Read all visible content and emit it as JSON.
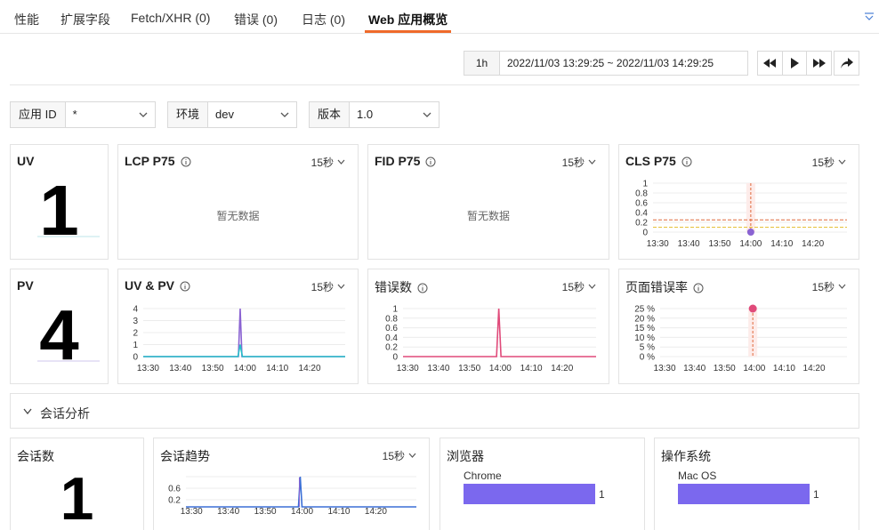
{
  "tabs": [
    "性能",
    "扩展字段",
    "Fetch/XHR (0)",
    "错误 (0)",
    "日志 (0)",
    "Web 应用概览"
  ],
  "time": {
    "range_button": "1h",
    "range_text": "2022/11/03 13:29:25 ~ 2022/11/03 14:29:25"
  },
  "filters": [
    {
      "label": "应用 ID",
      "value": "*"
    },
    {
      "label": "环境",
      "value": "dev"
    },
    {
      "label": "版本",
      "value": "1.0"
    }
  ],
  "interval_label": "15秒",
  "no_data_text": "暂无数据",
  "panels": {
    "uv": {
      "title": "UV",
      "value": "1"
    },
    "lcp": {
      "title": "LCP P75"
    },
    "fid": {
      "title": "FID P75"
    },
    "cls": {
      "title": "CLS P75"
    },
    "pv": {
      "title": "PV",
      "value": "4"
    },
    "uvpv": {
      "title": "UV & PV"
    },
    "errors": {
      "title": "错误数"
    },
    "error_rate": {
      "title": "页面错误率"
    }
  },
  "session": {
    "header": "会话分析",
    "count_title": "会话数",
    "count_value": "1",
    "trend_title": "会话趋势",
    "browser_title": "浏览器",
    "os_title": "操作系统",
    "browser_bar": {
      "label": "Chrome",
      "value": "1"
    },
    "os_bar": {
      "label": "Mac OS",
      "value": "1"
    }
  },
  "x_ticks": [
    "13:30",
    "13:40",
    "13:50",
    "14:00",
    "14:10",
    "14:20"
  ],
  "colors": {
    "accent": "#ef6a2a",
    "teal": "#26c0c8",
    "purple": "#8a63d2",
    "pink": "#e04a7a",
    "blue": "#3b6fd6",
    "bar": "#7b68ee"
  },
  "chart_data": [
    {
      "type": "scatter",
      "name_ref": "CLS P75",
      "x_ticks": [
        "13:30",
        "13:40",
        "13:50",
        "14:00",
        "14:10",
        "14:20"
      ],
      "y_ticks": [
        "0",
        "0.2",
        "0.4",
        "0.6",
        "0.8",
        "1"
      ],
      "ylim": [
        0,
        1
      ],
      "points": [
        {
          "x": "14:00",
          "y": 0
        }
      ],
      "thresholds": [
        0.25,
        0.1
      ]
    },
    {
      "type": "line",
      "name_ref": "UV & PV",
      "x_ticks": [
        "13:30",
        "13:40",
        "13:50",
        "14:00",
        "14:10",
        "14:20"
      ],
      "y_ticks": [
        "0",
        "1",
        "2",
        "3",
        "4"
      ],
      "ylim": [
        0,
        4
      ],
      "series": [
        {
          "color": "#8a63d2",
          "peak_x": "13:58:30",
          "peak_y": 4
        },
        {
          "color": "#26c0c8",
          "peak_x": "13:58:30",
          "peak_y": 1
        }
      ]
    },
    {
      "type": "line",
      "name_ref": "错误数",
      "x_ticks": [
        "13:30",
        "13:40",
        "13:50",
        "14:00",
        "14:10",
        "14:20"
      ],
      "y_ticks": [
        "0",
        "0.2",
        "0.4",
        "0.6",
        "0.8",
        "1"
      ],
      "ylim": [
        0,
        1
      ],
      "series": [
        {
          "color": "#e04a7a",
          "peak_x": "13:59:30",
          "peak_y": 1
        }
      ]
    },
    {
      "type": "scatter",
      "name_ref": "页面错误率",
      "x_ticks": [
        "13:30",
        "13:40",
        "13:50",
        "14:00",
        "14:10",
        "14:20"
      ],
      "y_ticks": [
        "0 %",
        "5 %",
        "10 %",
        "15 %",
        "20 %",
        "25 %"
      ],
      "ylim": [
        0,
        25
      ],
      "points": [
        {
          "x": "13:59:30",
          "y": 25
        }
      ]
    },
    {
      "type": "line",
      "name_ref": "会话趋势",
      "x_ticks": [
        "13:30",
        "13:40",
        "13:50",
        "14:00",
        "14:10",
        "14:20"
      ],
      "y_ticks": [
        "0.2",
        "0.6"
      ],
      "series": [
        {
          "color": "#3b6fd6",
          "peak_x": "13:59:30",
          "peak_y": 1
        }
      ]
    },
    {
      "type": "bar",
      "name_ref": "浏览器",
      "categories": [
        "Chrome"
      ],
      "values": [
        1
      ]
    },
    {
      "type": "bar",
      "name_ref": "操作系统",
      "categories": [
        "Mac OS"
      ],
      "values": [
        1
      ]
    }
  ]
}
